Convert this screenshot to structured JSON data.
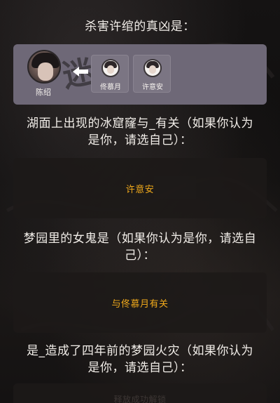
{
  "questions": {
    "q1": "杀害许绾的真凶是：",
    "q2_line1": "湖面上出现的冰窟窿与_有关（如果你认为",
    "q2_line2": "是你，请选自己）：",
    "q3_line1": "梦园里的女鬼是（如果你认为是你，请选自",
    "q3_line2": "己）：",
    "q4_line1": "是_造成了四年前的梦园火灾（如果你认为",
    "q4_line2": "是你，请选自己）："
  },
  "suspects": {
    "selected_name": "陈绍",
    "chips": [
      "佟慕月",
      "许意安"
    ]
  },
  "answers": {
    "a2": "许意安",
    "a3": "与佟慕月有关",
    "a4": "释放成功解锁"
  },
  "colors": {
    "accent": "#f0a91b",
    "panel": "#6e6877",
    "option_bg": "#1c1918"
  }
}
